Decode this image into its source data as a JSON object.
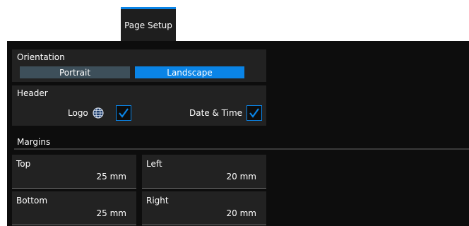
{
  "tab": {
    "label": "Page Setup"
  },
  "orientation": {
    "title": "Orientation",
    "options": [
      "Portrait",
      "Landscape"
    ],
    "selected": "Landscape"
  },
  "header": {
    "title": "Header",
    "logo": {
      "label": "Logo",
      "checked": true,
      "icon": "globe-icon"
    },
    "datetime": {
      "label": "Date & Time",
      "checked": true
    }
  },
  "margins": {
    "title": "Margins",
    "top": {
      "label": "Top",
      "value": "25 mm"
    },
    "left": {
      "label": "Left",
      "value": "20 mm"
    },
    "bottom": {
      "label": "Bottom",
      "value": "25 mm"
    },
    "right": {
      "label": "Right",
      "value": "20 mm"
    }
  },
  "colors": {
    "accent": "#0a84e6",
    "panel": "#0d0d0d",
    "group": "#222222"
  }
}
